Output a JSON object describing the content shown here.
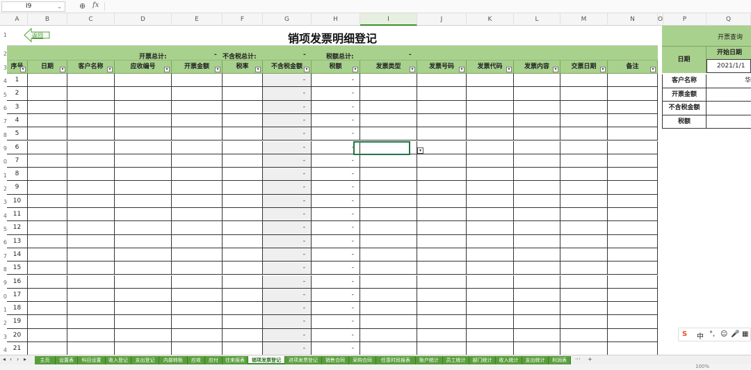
{
  "formula_bar": {
    "cell_ref": "I9",
    "fx_label": "fx"
  },
  "columns": [
    "A",
    "B",
    "C",
    "D",
    "E",
    "F",
    "G",
    "H",
    "I",
    "J",
    "K",
    "L",
    "M",
    "N",
    "O",
    "P",
    "Q"
  ],
  "row_numbers": [
    "1",
    "2",
    "3",
    "4",
    "5",
    "6",
    "7",
    "8",
    "9",
    "0",
    "1",
    "2",
    "3",
    "4",
    "5",
    "6",
    "7",
    "8",
    "9",
    "0",
    "1",
    "2",
    "3",
    "4"
  ],
  "sheet": {
    "back_label": "返回",
    "title": "销项发票明细登记",
    "summary": {
      "total_invoice_label": "开票总计:",
      "total_invoice_value": "-",
      "excl_tax_label": "不含税总计:",
      "excl_tax_value": "-",
      "tax_label": "税额总计:",
      "tax_value": "-"
    },
    "headers": [
      "序号",
      "日期",
      "客户名称",
      "应收编号",
      "开票金额",
      "税率",
      "不含税金额",
      "税额",
      "发票类型",
      "发票号码",
      "发票代码",
      "发票内容",
      "交票日期",
      "备注"
    ],
    "rows": [
      {
        "no": "1",
        "excl": "-",
        "tax": "-"
      },
      {
        "no": "2",
        "excl": "-",
        "tax": "-"
      },
      {
        "no": "3",
        "excl": "-",
        "tax": "-"
      },
      {
        "no": "4",
        "excl": "-",
        "tax": "-"
      },
      {
        "no": "5",
        "excl": "-",
        "tax": "-"
      },
      {
        "no": "6",
        "excl": "-",
        "tax": "-"
      },
      {
        "no": "7",
        "excl": "-",
        "tax": "-"
      },
      {
        "no": "8",
        "excl": "-",
        "tax": "-"
      },
      {
        "no": "9",
        "excl": "-",
        "tax": "-"
      },
      {
        "no": "10",
        "excl": "-",
        "tax": "-"
      },
      {
        "no": "11",
        "excl": "-",
        "tax": "-"
      },
      {
        "no": "12",
        "excl": "-",
        "tax": "-"
      },
      {
        "no": "13",
        "excl": "-",
        "tax": "-"
      },
      {
        "no": "14",
        "excl": "-",
        "tax": "-"
      },
      {
        "no": "15",
        "excl": "-",
        "tax": "-"
      },
      {
        "no": "16",
        "excl": "-",
        "tax": "-"
      },
      {
        "no": "17",
        "excl": "-",
        "tax": "-"
      },
      {
        "no": "18",
        "excl": "-",
        "tax": "-"
      },
      {
        "no": "19",
        "excl": "-",
        "tax": "-"
      },
      {
        "no": "20",
        "excl": "-",
        "tax": "-"
      },
      {
        "no": "21",
        "excl": "-",
        "tax": "-"
      }
    ]
  },
  "query_panel": {
    "title": "开票查询",
    "date_label": "日期",
    "start_date_label": "开始日期",
    "start_date_value": "2021/1/1",
    "customer_label": "客户名称",
    "customer_value": "华",
    "amount_label": "开票金额",
    "excl_label": "不含税金额",
    "tax_label": "税额"
  },
  "ime": {
    "s": "S",
    "zh": "中",
    "dot": "°,",
    "emoji": "☺",
    "mic": "🎤",
    "grid": "▦"
  },
  "tabs": [
    "主页",
    "设置表",
    "科目设置",
    "收入登记",
    "支出登记",
    "内部转账",
    "应收",
    "应付",
    "往来报表",
    "销项发票登记",
    "进项发票登记",
    "销售合同",
    "采购合同",
    "任意时段报表",
    "账户统计",
    "员工统计",
    "部门统计",
    "收入统计",
    "支出统计",
    "利润表"
  ],
  "active_tab": "销项发票登记",
  "tab_more": "···",
  "tab_add": "+",
  "zoom": "100%",
  "colors": {
    "header_green": "#a9d18e",
    "tab_green": "#5a9e3c",
    "select_green": "#217346"
  }
}
